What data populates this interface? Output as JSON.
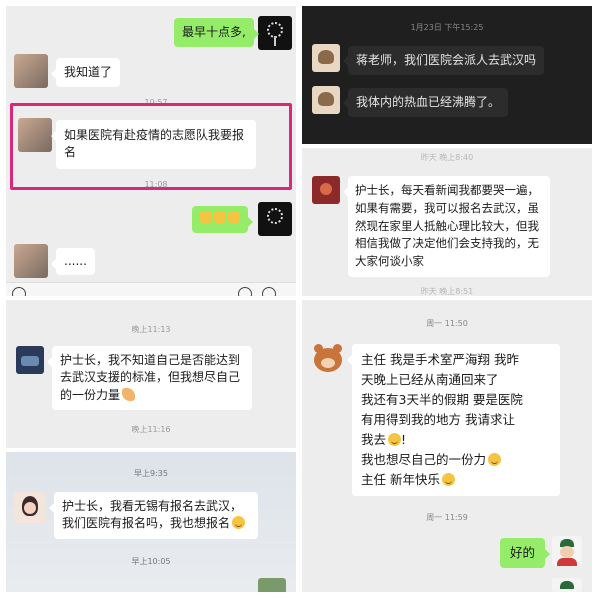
{
  "panels": {
    "top_left": {
      "messages": [
        {
          "text": "最早十点多,",
          "side": "right"
        },
        {
          "text": "我知道了",
          "side": "left"
        },
        {
          "text": "如果医院有赴疫情的志愿队我要报名",
          "side": "left"
        },
        {
          "text": "👍👍👍",
          "side": "right"
        },
        {
          "text": "......",
          "side": "left"
        }
      ],
      "timestamps": [
        "10:57",
        "11:08"
      ]
    },
    "top_right": {
      "timestamps": [
        "1月23日 下午15:25",
        "昨天 晚上8:40"
      ],
      "messages": [
        {
          "text": "蒋老师，我们医院会派人去武汉吗",
          "side": "left"
        },
        {
          "text": "我体内的热血已经沸腾了。",
          "side": "left"
        }
      ]
    },
    "middle_right": {
      "message": {
        "text": "护士长，每天看新闻我都要哭一遍，如果有需要，我可以报名去武汉，虽然现在家里人抵触心理比较大，但我相信我做了决定他们会支持我的，无大家何谈小家",
        "side": "left"
      },
      "timestamps": [
        "昨天 晚上8:51"
      ]
    },
    "middle_left": {
      "timestamps": [
        "晚上11:13",
        "晚上11:16"
      ],
      "message": {
        "text": "护士长，我不知道自己是否能达到去武汉支援的标准，但我想尽自己的一份力量",
        "side": "left"
      }
    },
    "bottom_left": {
      "timestamps": [
        "早上9:35",
        "早上10:05"
      ],
      "message": {
        "text": "护士长，我看无锡有报名去武汉，我们医院有报名吗，我也想报名",
        "side": "left"
      }
    },
    "bottom_right": {
      "timestamps": [
        "周一 11:50",
        "周一 11:59"
      ],
      "messages": [
        {
          "lines": [
            "主任  我是手术室严海翔  我昨",
            "天晚上已经从南通回来了",
            "我还有3天半的假期  要是医院",
            "有用得到我的地方  我请求让",
            "我去",
            "我也想尽自己的一份力",
            "主任  新年快乐"
          ],
          "side": "left"
        },
        {
          "text": "好的",
          "side": "right"
        }
      ]
    }
  },
  "colors": {
    "wechat_green": "#95ec69",
    "highlight": "#d8287a",
    "dark_bg": "#1f1f1f"
  },
  "icons": [
    "voice-icon",
    "emoji-icon",
    "plus-icon"
  ]
}
